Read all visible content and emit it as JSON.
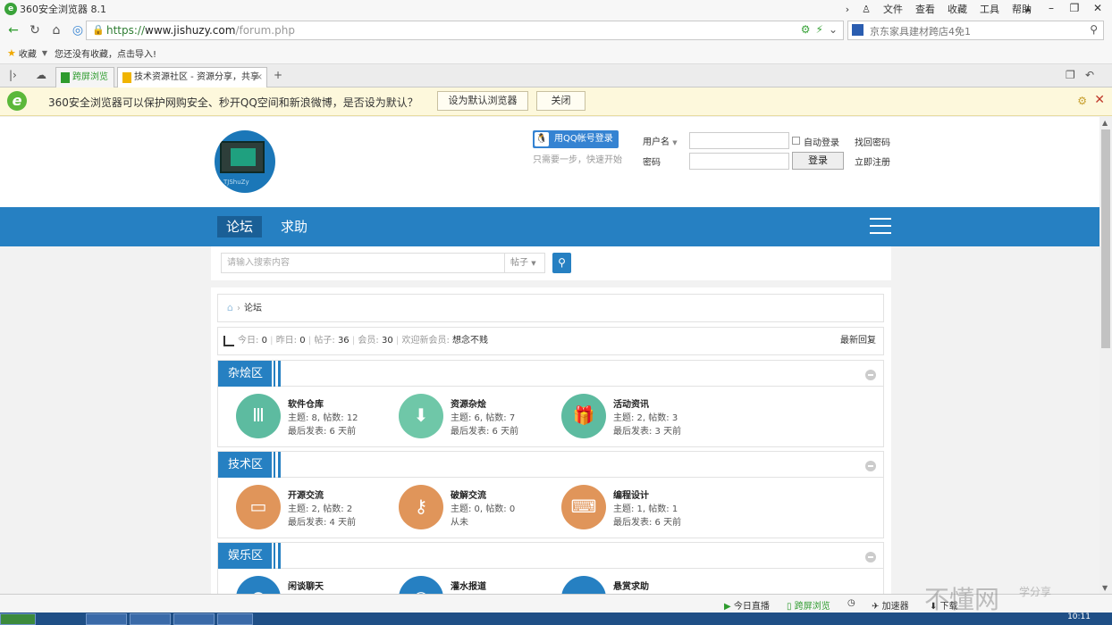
{
  "browser": {
    "title": "360安全浏览器 8.1",
    "menu": [
      "文件",
      "查看",
      "收藏",
      "工具",
      "帮助"
    ],
    "url_scheme": "https://",
    "url_host": "www.jishuzy.com",
    "url_path": "/forum.php",
    "search_placeholder": "京东家具建材跨店4免1",
    "favorites_label": "收藏",
    "favorites_hint": "您还没有收藏，点击导入!",
    "tabs": [
      {
        "label": "跨屏浏览"
      },
      {
        "label": "技术资源社区 - 资源分享，共享"
      }
    ],
    "infobar": {
      "message": "360安全浏览器可以保护网购安全、秒开QQ空间和新浪微博，是否设为默认？",
      "set_default": "设为默认浏览器",
      "close": "关闭"
    },
    "status_items": [
      "今日直播",
      "跨屏浏览",
      "加速器",
      "下载"
    ],
    "watermark": "不懂网",
    "watermark_sub": "学分享",
    "clock": "10:11"
  },
  "site": {
    "logo_text": "TJShuZy",
    "qq_login": "用QQ帐号登录",
    "qq_sub": "只需要一步，快速开始",
    "username_label": "用户名",
    "password_label": "密码",
    "auto_login": "自动登录",
    "login_button": "登录",
    "find_password": "找回密码",
    "register": "立即注册",
    "nav": [
      "论坛",
      "求助"
    ],
    "search_placeholder": "请输入搜索内容",
    "search_type": "帖子",
    "breadcrumb": "论坛",
    "stats": {
      "today_label": "今日:",
      "today": "0",
      "yesterday_label": "昨日:",
      "yesterday": "0",
      "posts_label": "帖子:",
      "posts": "36",
      "members_label": "会员:",
      "members": "30",
      "welcome_label": "欢迎新会员:",
      "welcome": "想念不贱",
      "latest": "最新回复"
    },
    "sections": [
      {
        "title": "杂烩区",
        "forums": [
          {
            "name": "软件仓库",
            "meta1": "主题: 8, 帖数: 12",
            "meta2": "最后发表: 6 天前",
            "color": "#5dbba0",
            "icon": "sliders-icon",
            "glyph": "Ⅲ"
          },
          {
            "name": "资源杂烩",
            "meta1": "主题: 6, 帖数: 7",
            "meta2": "最后发表: 6 天前",
            "color": "#6fc7a8",
            "icon": "download-icon",
            "glyph": "⬇"
          },
          {
            "name": "活动资讯",
            "meta1": "主题: 2, 帖数: 3",
            "meta2": "最后发表: 3 天前",
            "color": "#5dbba0",
            "icon": "gift-icon",
            "glyph": "🎁"
          }
        ]
      },
      {
        "title": "技术区",
        "forums": [
          {
            "name": "开源交流",
            "meta1": "主题: 2, 帖数: 2",
            "meta2": "最后发表: 4 天前",
            "color": "#e0955a",
            "icon": "folder-icon",
            "glyph": "▭"
          },
          {
            "name": "破解交流",
            "meta1": "主题: 0, 帖数: 0",
            "meta2": "从未",
            "color": "#e0955a",
            "icon": "key-icon",
            "glyph": "⚷"
          },
          {
            "name": "编程设计",
            "meta1": "主题: 1, 帖数: 1",
            "meta2": "最后发表: 6 天前",
            "color": "#e0955a",
            "icon": "keyboard-icon",
            "glyph": "⌨"
          }
        ]
      },
      {
        "title": "娱乐区",
        "forums": [
          {
            "name": "闲谈聊天",
            "meta1": "",
            "meta2": "",
            "color": "#2680c2",
            "icon": "chat-icon",
            "glyph": "●"
          },
          {
            "name": "灌水报道",
            "meta1": "",
            "meta2": "",
            "color": "#2680c2",
            "icon": "target-icon",
            "glyph": "◎"
          },
          {
            "name": "悬赏求助",
            "meta1": "",
            "meta2": "",
            "color": "#2680c2",
            "icon": "screen-icon",
            "glyph": "▬"
          }
        ]
      }
    ]
  }
}
